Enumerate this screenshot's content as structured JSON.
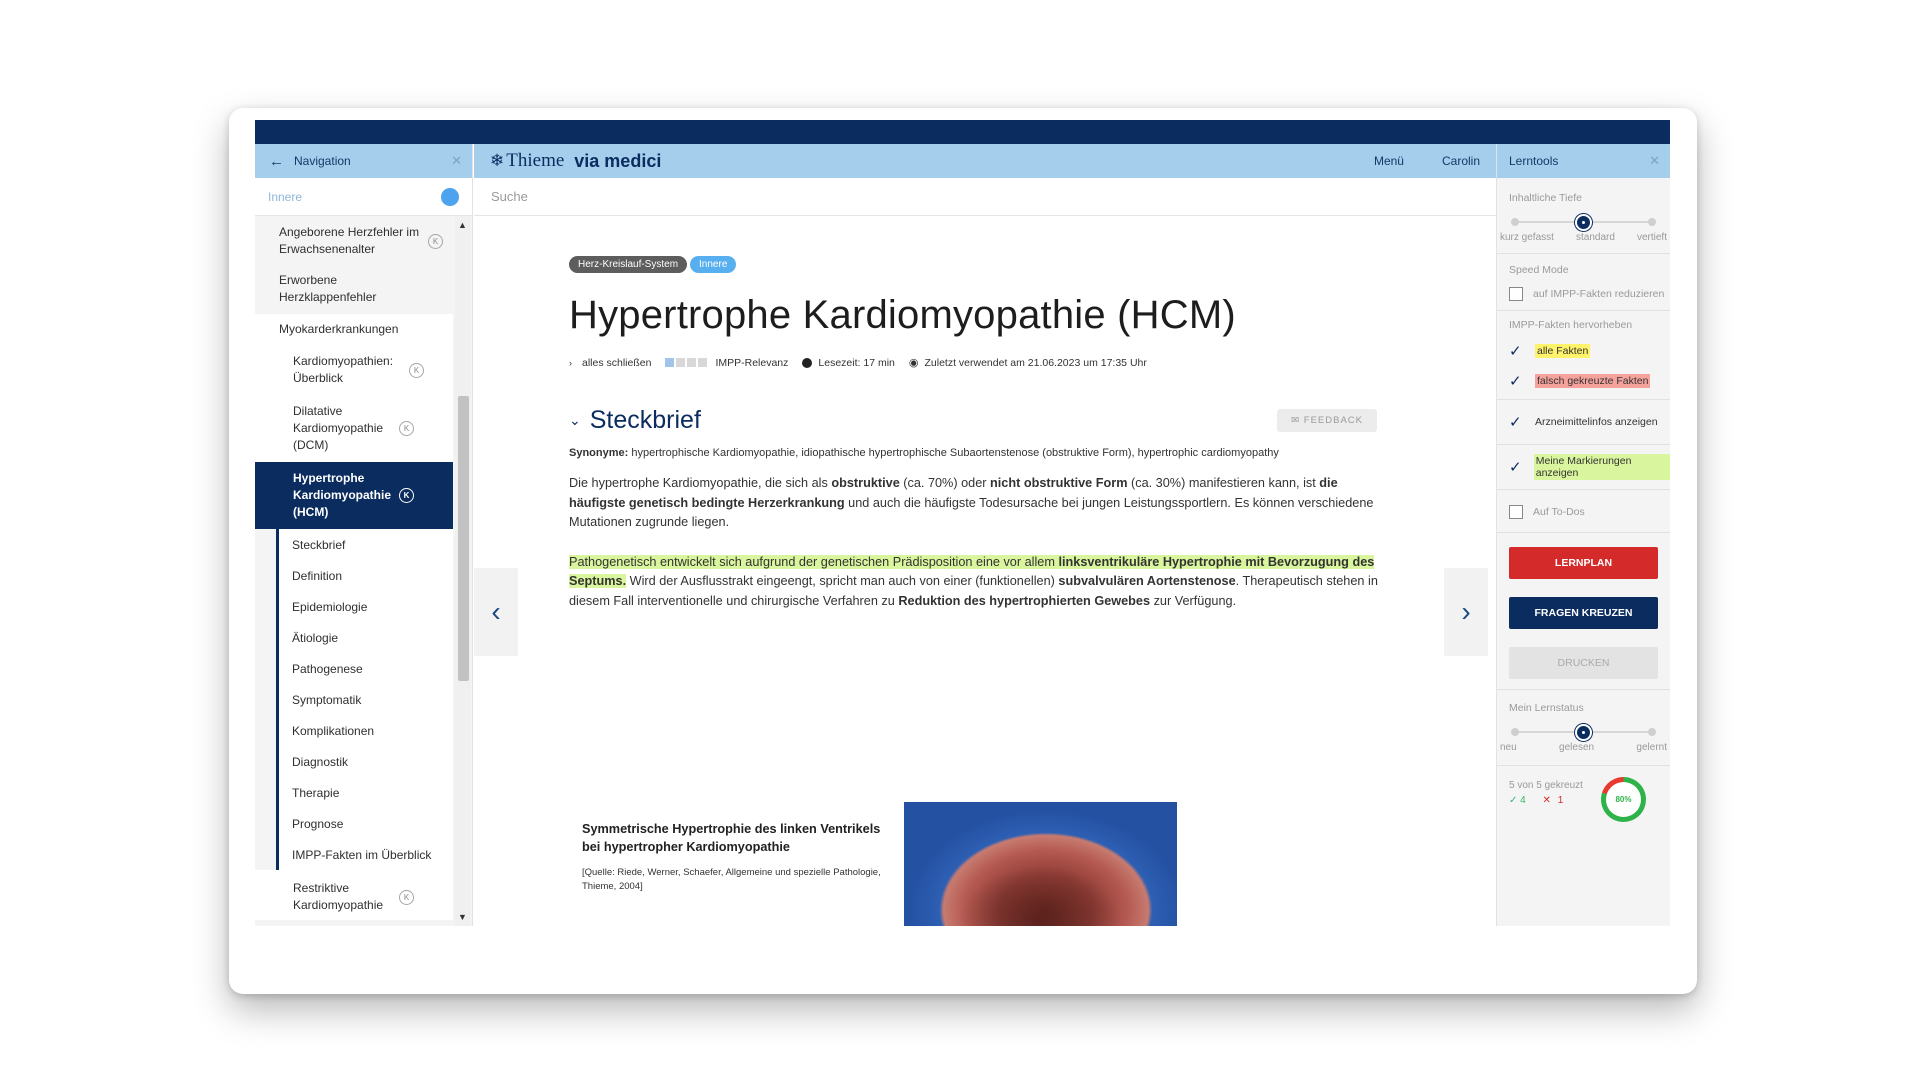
{
  "nav": {
    "header": "Navigation",
    "filter": "Innere",
    "items": [
      {
        "label": "Angeborene Herzfehler im Erwachsenenalter",
        "badge": "K"
      },
      {
        "label": "Erworbene Herzklappenfehler"
      },
      {
        "label": "Myokarderkrankungen"
      },
      {
        "label": "Kardiomyopathien: Überblick",
        "badge": "K"
      },
      {
        "label": "Dilatative Kardiomyopathie (DCM)",
        "badge": "K"
      },
      {
        "label": "Hypertrophe Kardiomyopathie (HCM)",
        "badge": "K"
      },
      {
        "label": "Restriktive Kardiomyopathie",
        "badge": "K"
      }
    ],
    "subitems": [
      "Steckbrief",
      "Definition",
      "Epidemiologie",
      "Ätiologie",
      "Pathogenese",
      "Symptomatik",
      "Komplikationen",
      "Diagnostik",
      "Therapie",
      "Prognose",
      "IMPP-Fakten im Überblick"
    ]
  },
  "header": {
    "brand": "Thieme",
    "brand2": "via medici",
    "menu": "Menü",
    "user": "Carolin"
  },
  "search": {
    "placeholder": "Suche"
  },
  "article": {
    "tags": [
      "Herz-Kreislauf-System",
      "Innere"
    ],
    "title": "Hypertrophe Kardiomyopathie (HCM)",
    "meta": {
      "collapse": "alles schließen",
      "impp": "IMPP-Relevanz",
      "impp_level": 1,
      "readtime": "Lesezeit: 17 min",
      "lastused": "Zuletzt verwendet am 21.06.2023 um 17:35 Uhr"
    },
    "section": "Steckbrief",
    "feedback": "FEEDBACK",
    "syn_label": "Synonyme:",
    "syn_text": "hypertrophische Kardiomyopathie, idiopathische hypertrophische Subaortenstenose (obstruktive Form), hypertrophic cardiomyopathy",
    "p1": [
      "Die hypertrophe Kardiomyopathie, die sich als ",
      "obstruktive",
      " (ca. 70%) oder ",
      "nicht obstruktive Form",
      " (ca. 30%) manifestieren kann, ist ",
      "die häufigste genetisch bedingte Herzerkrankung",
      " und auch die häufigste Todesursache bei jungen Leistungssportlern. Es können verschiedene Mutationen zugrunde liegen."
    ],
    "p2": [
      "Pathogenetisch entwickelt sich aufgrund der genetischen Prädisposition eine vor allem ",
      "linksventrikuläre Hypertrophie mit Bevorzugung des Septums.",
      " Wird der Ausflusstrakt eingeengt, spricht man auch von einer (funktionellen) ",
      "subvalvulären Aortenstenose",
      ". Therapeutisch stehen in diesem Fall interventionelle und chirurgische Verfahren zu ",
      "Reduktion des hypertrophierten Gewebes",
      " zur Verfügung."
    ],
    "figure": {
      "title": "Symmetrische Hypertrophie des linken Ventrikels bei hypertropher Kardiomyopathie",
      "source": "[Quelle: Riede, Werner, Schaefer, Allgemeine und spezielle Pathologie, Thieme, 2004]"
    }
  },
  "tools": {
    "header": "Lerntools",
    "depth_label": "Inhaltliche Tiefe",
    "depth_ticks": [
      "kurz gefasst",
      "standard",
      "vertieft"
    ],
    "depth_value": 0.5,
    "speed_label": "Speed Mode",
    "speed_opt": "auf IMPP-Fakten reduzieren",
    "impp_label": "IMPP-Fakten hervorheben",
    "impp_all": "alle Fakten",
    "impp_wrong": "falsch gekreuzte Fakten",
    "drug_info": "Arzneimittelinfos anzeigen",
    "my_marks": "Meine Markierungen anzeigen",
    "todo": "Auf To-Dos",
    "btn_plan": "LERNPLAN",
    "btn_questions": "FRAGEN KREUZEN",
    "btn_print": "DRUCKEN",
    "status_label": "Mein Lernstatus",
    "status_ticks": [
      "neu",
      "gelesen",
      "gelernt"
    ],
    "status_value": 0.5,
    "crossed": "5 von 5 gekreuzt",
    "correct": "4",
    "wrong": "1",
    "percent": "80%",
    "colors": {
      "correct": "#2eb34a",
      "wrong": "#e83a30",
      "primary": "#0a2c5f",
      "danger": "#d42a2a"
    }
  }
}
